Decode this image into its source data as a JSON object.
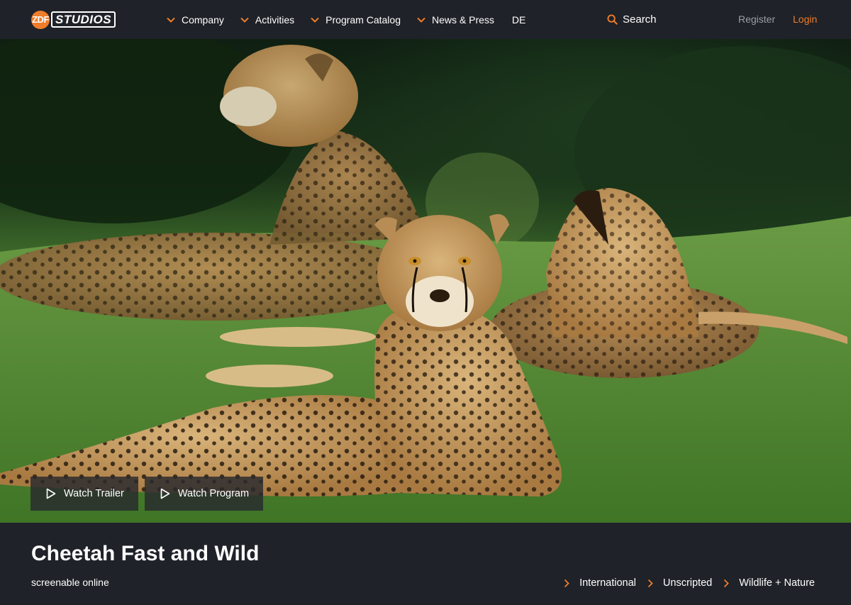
{
  "brand": {
    "logo_mark": "ZDF",
    "logo_text": "STUDIOS"
  },
  "nav": {
    "items": [
      {
        "label": "Company"
      },
      {
        "label": "Activities"
      },
      {
        "label": "Program Catalog"
      },
      {
        "label": "News & Press"
      }
    ],
    "language": "DE",
    "search_label": "Search",
    "register_label": "Register",
    "login_label": "Login"
  },
  "hero": {
    "buttons": [
      {
        "label": "Watch Trailer",
        "icon": "play-icon"
      },
      {
        "label": "Watch Program",
        "icon": "play-icon"
      }
    ]
  },
  "program": {
    "title": "Cheetah Fast and Wild",
    "subtitle": "screenable online",
    "categories": [
      {
        "label": "International"
      },
      {
        "label": "Unscripted"
      },
      {
        "label": "Wildlife + Nature"
      }
    ]
  },
  "colors": {
    "accent": "#f07d2a",
    "background": "#1f2228",
    "muted": "#9aa0a8"
  }
}
